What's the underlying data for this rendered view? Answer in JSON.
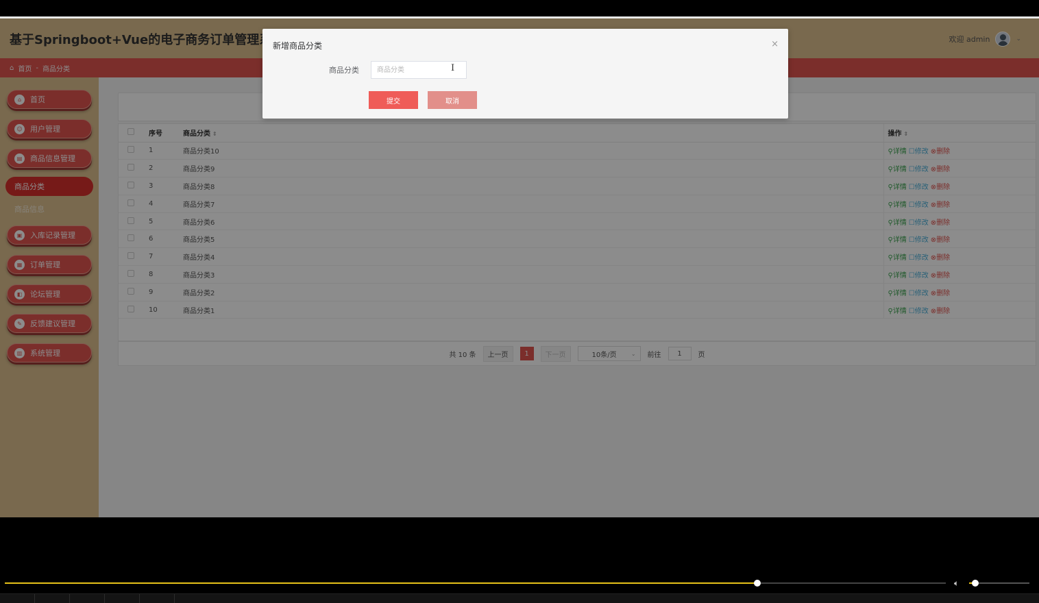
{
  "app": {
    "title": "基于Springboot+Vue的电子商务订单管理系统设",
    "welcome": "欢迎 admin"
  },
  "breadcrumb": {
    "home": "首页",
    "separator": "-",
    "current": "商品分类"
  },
  "sidebar": {
    "items": [
      {
        "label": "首页",
        "icon": "home-icon"
      },
      {
        "label": "用户管理",
        "icon": "user-icon"
      },
      {
        "label": "商品信息管理",
        "icon": "goods-icon"
      },
      {
        "label": "商品分类",
        "icon": "",
        "active": true
      },
      {
        "label": "商品信息",
        "icon": ""
      },
      {
        "label": "入库记录管理",
        "icon": "inbound-icon"
      },
      {
        "label": "订单管理",
        "icon": "order-icon"
      },
      {
        "label": "论坛管理",
        "icon": "forum-icon"
      },
      {
        "label": "反馈建议管理",
        "icon": "feedback-icon"
      },
      {
        "label": "系统管理",
        "icon": "system-icon"
      }
    ]
  },
  "table": {
    "headers": {
      "index": "序号",
      "name": "商品分类",
      "ops": "操作"
    },
    "ops": {
      "detail": "详情",
      "edit": "修改",
      "del": "删除"
    },
    "rows": [
      {
        "index": "1",
        "name": "商品分类10"
      },
      {
        "index": "2",
        "name": "商品分类9"
      },
      {
        "index": "3",
        "name": "商品分类8"
      },
      {
        "index": "4",
        "name": "商品分类7"
      },
      {
        "index": "5",
        "name": "商品分类6"
      },
      {
        "index": "6",
        "name": "商品分类5"
      },
      {
        "index": "7",
        "name": "商品分类4"
      },
      {
        "index": "8",
        "name": "商品分类3"
      },
      {
        "index": "9",
        "name": "商品分类2"
      },
      {
        "index": "10",
        "name": "商品分类1"
      }
    ]
  },
  "pagination": {
    "total": "共 10 条",
    "prev": "上一页",
    "current": "1",
    "next": "下一页",
    "page_size": "10条/页",
    "goto": "前往",
    "goto_value": "1",
    "page_unit": "页"
  },
  "dialog": {
    "title": "新增商品分类",
    "close": "×",
    "field_label": "商品分类",
    "field_placeholder": "商品分类",
    "submit": "提交",
    "cancel": "取消"
  },
  "player": {
    "progress": 0.8,
    "volume": 0.1
  },
  "colors": {
    "accent": "#e0544f",
    "header_bg": "#dcbf8e",
    "progress": "#e8c31a"
  }
}
